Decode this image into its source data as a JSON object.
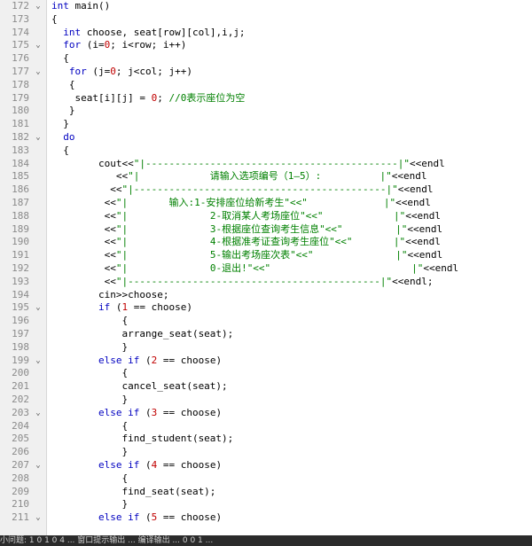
{
  "editor": {
    "lines": [
      {
        "num": "172",
        "fold": "v",
        "parts": [
          [
            "kw",
            "int"
          ],
          [
            "",
            "main()"
          ]
        ]
      },
      {
        "num": "173",
        "fold": "",
        "parts": [
          [
            "",
            "{"
          ]
        ]
      },
      {
        "num": "174",
        "fold": "",
        "parts": [
          [
            "",
            "  "
          ],
          [
            "kw",
            "int"
          ],
          [
            "",
            "choose, seat[row][col],i,j;"
          ]
        ]
      },
      {
        "num": "175",
        "fold": "v",
        "parts": [
          [
            "",
            "  "
          ],
          [
            "kw",
            "for"
          ],
          [
            "",
            " (i="
          ],
          [
            "num",
            "0"
          ],
          [
            "",
            "; i<row; i++)"
          ]
        ]
      },
      {
        "num": "176",
        "fold": "",
        "parts": [
          [
            "",
            "  {"
          ]
        ]
      },
      {
        "num": "177",
        "fold": "v",
        "parts": [
          [
            "",
            "   "
          ],
          [
            "kw",
            "for"
          ],
          [
            "",
            " (j="
          ],
          [
            "num",
            "0"
          ],
          [
            "",
            "; j<col; j++)"
          ]
        ]
      },
      {
        "num": "178",
        "fold": "",
        "parts": [
          [
            "",
            "   {"
          ]
        ]
      },
      {
        "num": "179",
        "fold": "",
        "parts": [
          [
            "",
            "    seat[i][j] = "
          ],
          [
            "num",
            "0"
          ],
          [
            "",
            "; "
          ],
          [
            "cmt",
            "//0表示座位为空"
          ]
        ]
      },
      {
        "num": "180",
        "fold": "",
        "parts": [
          [
            "",
            "   }"
          ]
        ]
      },
      {
        "num": "181",
        "fold": "",
        "parts": [
          [
            "",
            "  }"
          ]
        ]
      },
      {
        "num": "182",
        "fold": "v",
        "parts": [
          [
            "",
            "  "
          ],
          [
            "kw",
            "do"
          ]
        ]
      },
      {
        "num": "183",
        "fold": "",
        "parts": [
          [
            "",
            "  {"
          ]
        ]
      },
      {
        "num": "184",
        "fold": "",
        "parts": [
          [
            "",
            "        cout<<"
          ],
          [
            "str",
            "\"|-------------------------------------------|\""
          ],
          [
            "",
            "<<endl"
          ]
        ]
      },
      {
        "num": "185",
        "fold": "",
        "parts": [
          [
            "",
            "           <<"
          ],
          [
            "str",
            "\"|            请输入选项编号（1—5）:          |\""
          ],
          [
            "",
            "<<endl"
          ]
        ]
      },
      {
        "num": "186",
        "fold": "",
        "parts": [
          [
            "",
            "          <<"
          ],
          [
            "str",
            "\"|-------------------------------------------|\""
          ],
          [
            "",
            "<<endl"
          ]
        ]
      },
      {
        "num": "187",
        "fold": "",
        "parts": [
          [
            "",
            "         <<"
          ],
          [
            "str",
            "\"|       输入:1-安排座位给新考生\"<<\"             |\""
          ],
          [
            "",
            "<<endl"
          ]
        ]
      },
      {
        "num": "188",
        "fold": "",
        "parts": [
          [
            "",
            "         <<"
          ],
          [
            "str",
            "\"|              2-取消某人考场座位\"<<\"            |\""
          ],
          [
            "",
            "<<endl"
          ]
        ]
      },
      {
        "num": "189",
        "fold": "",
        "parts": [
          [
            "",
            "         <<"
          ],
          [
            "str",
            "\"|              3-根据座位查询考生信息\"<<\"         |\""
          ],
          [
            "",
            "<<endl"
          ]
        ]
      },
      {
        "num": "190",
        "fold": "",
        "parts": [
          [
            "",
            "         <<"
          ],
          [
            "str",
            "\"|              4-根据准考证查询考生座位\"<<\"       |\""
          ],
          [
            "",
            "<<endl"
          ]
        ]
      },
      {
        "num": "191",
        "fold": "",
        "parts": [
          [
            "",
            "         <<"
          ],
          [
            "str",
            "\"|              5-输出考场座次表\"<<\"              |\""
          ],
          [
            "",
            "<<endl"
          ]
        ]
      },
      {
        "num": "192",
        "fold": "",
        "parts": [
          [
            "",
            "         <<"
          ],
          [
            "str",
            "\"|              0-退出!\"<<\"                        |\""
          ],
          [
            "",
            "<<endl"
          ]
        ]
      },
      {
        "num": "193",
        "fold": "",
        "parts": [
          [
            "",
            "         <<"
          ],
          [
            "str",
            "\"|-------------------------------------------|\""
          ],
          [
            "",
            "<<endl;"
          ]
        ]
      },
      {
        "num": "194",
        "fold": "",
        "parts": [
          [
            "",
            "        cin>>choose;"
          ]
        ]
      },
      {
        "num": "195",
        "fold": "v",
        "parts": [
          [
            "",
            "        "
          ],
          [
            "kw",
            "if"
          ],
          [
            "",
            " ("
          ],
          [
            "num",
            "1"
          ],
          [
            "",
            " == choose)"
          ]
        ]
      },
      {
        "num": "196",
        "fold": "",
        "parts": [
          [
            "",
            "            {"
          ]
        ]
      },
      {
        "num": "197",
        "fold": "",
        "parts": [
          [
            "",
            "            arrange_seat(seat);"
          ]
        ]
      },
      {
        "num": "198",
        "fold": "",
        "parts": [
          [
            "",
            "            }"
          ]
        ]
      },
      {
        "num": "199",
        "fold": "v",
        "parts": [
          [
            "",
            "        "
          ],
          [
            "kw",
            "else if"
          ],
          [
            "",
            " ("
          ],
          [
            "num",
            "2"
          ],
          [
            "",
            " == choose)"
          ]
        ]
      },
      {
        "num": "200",
        "fold": "",
        "parts": [
          [
            "",
            "            {"
          ]
        ]
      },
      {
        "num": "201",
        "fold": "",
        "parts": [
          [
            "",
            "            cancel_seat(seat);"
          ]
        ]
      },
      {
        "num": "202",
        "fold": "",
        "parts": [
          [
            "",
            "            }"
          ]
        ]
      },
      {
        "num": "203",
        "fold": "v",
        "parts": [
          [
            "",
            "        "
          ],
          [
            "kw",
            "else if"
          ],
          [
            "",
            " ("
          ],
          [
            "num",
            "3"
          ],
          [
            "",
            " == choose)"
          ]
        ]
      },
      {
        "num": "204",
        "fold": "",
        "parts": [
          [
            "",
            "            {"
          ]
        ]
      },
      {
        "num": "205",
        "fold": "",
        "parts": [
          [
            "",
            "            find_student(seat);"
          ]
        ]
      },
      {
        "num": "206",
        "fold": "",
        "parts": [
          [
            "",
            "            }"
          ]
        ]
      },
      {
        "num": "207",
        "fold": "v",
        "parts": [
          [
            "",
            "        "
          ],
          [
            "kw",
            "else if"
          ],
          [
            "",
            " ("
          ],
          [
            "num",
            "4"
          ],
          [
            "",
            " == choose)"
          ]
        ]
      },
      {
        "num": "208",
        "fold": "",
        "parts": [
          [
            "",
            "            {"
          ]
        ]
      },
      {
        "num": "209",
        "fold": "",
        "parts": [
          [
            "",
            "            find_seat(seat);"
          ]
        ]
      },
      {
        "num": "210",
        "fold": "",
        "parts": [
          [
            "",
            "            }"
          ]
        ]
      },
      {
        "num": "211",
        "fold": "v",
        "parts": [
          [
            "",
            "        "
          ],
          [
            "kw",
            "else if"
          ],
          [
            "",
            " ("
          ],
          [
            "num",
            "5"
          ],
          [
            "",
            " == choose)"
          ]
        ]
      }
    ]
  },
  "status_bar": {
    "text": "小问题: 1 0 1 0 4 ... 窗口提示输出 ... 编译输出 ... 0 0 1 ..."
  }
}
